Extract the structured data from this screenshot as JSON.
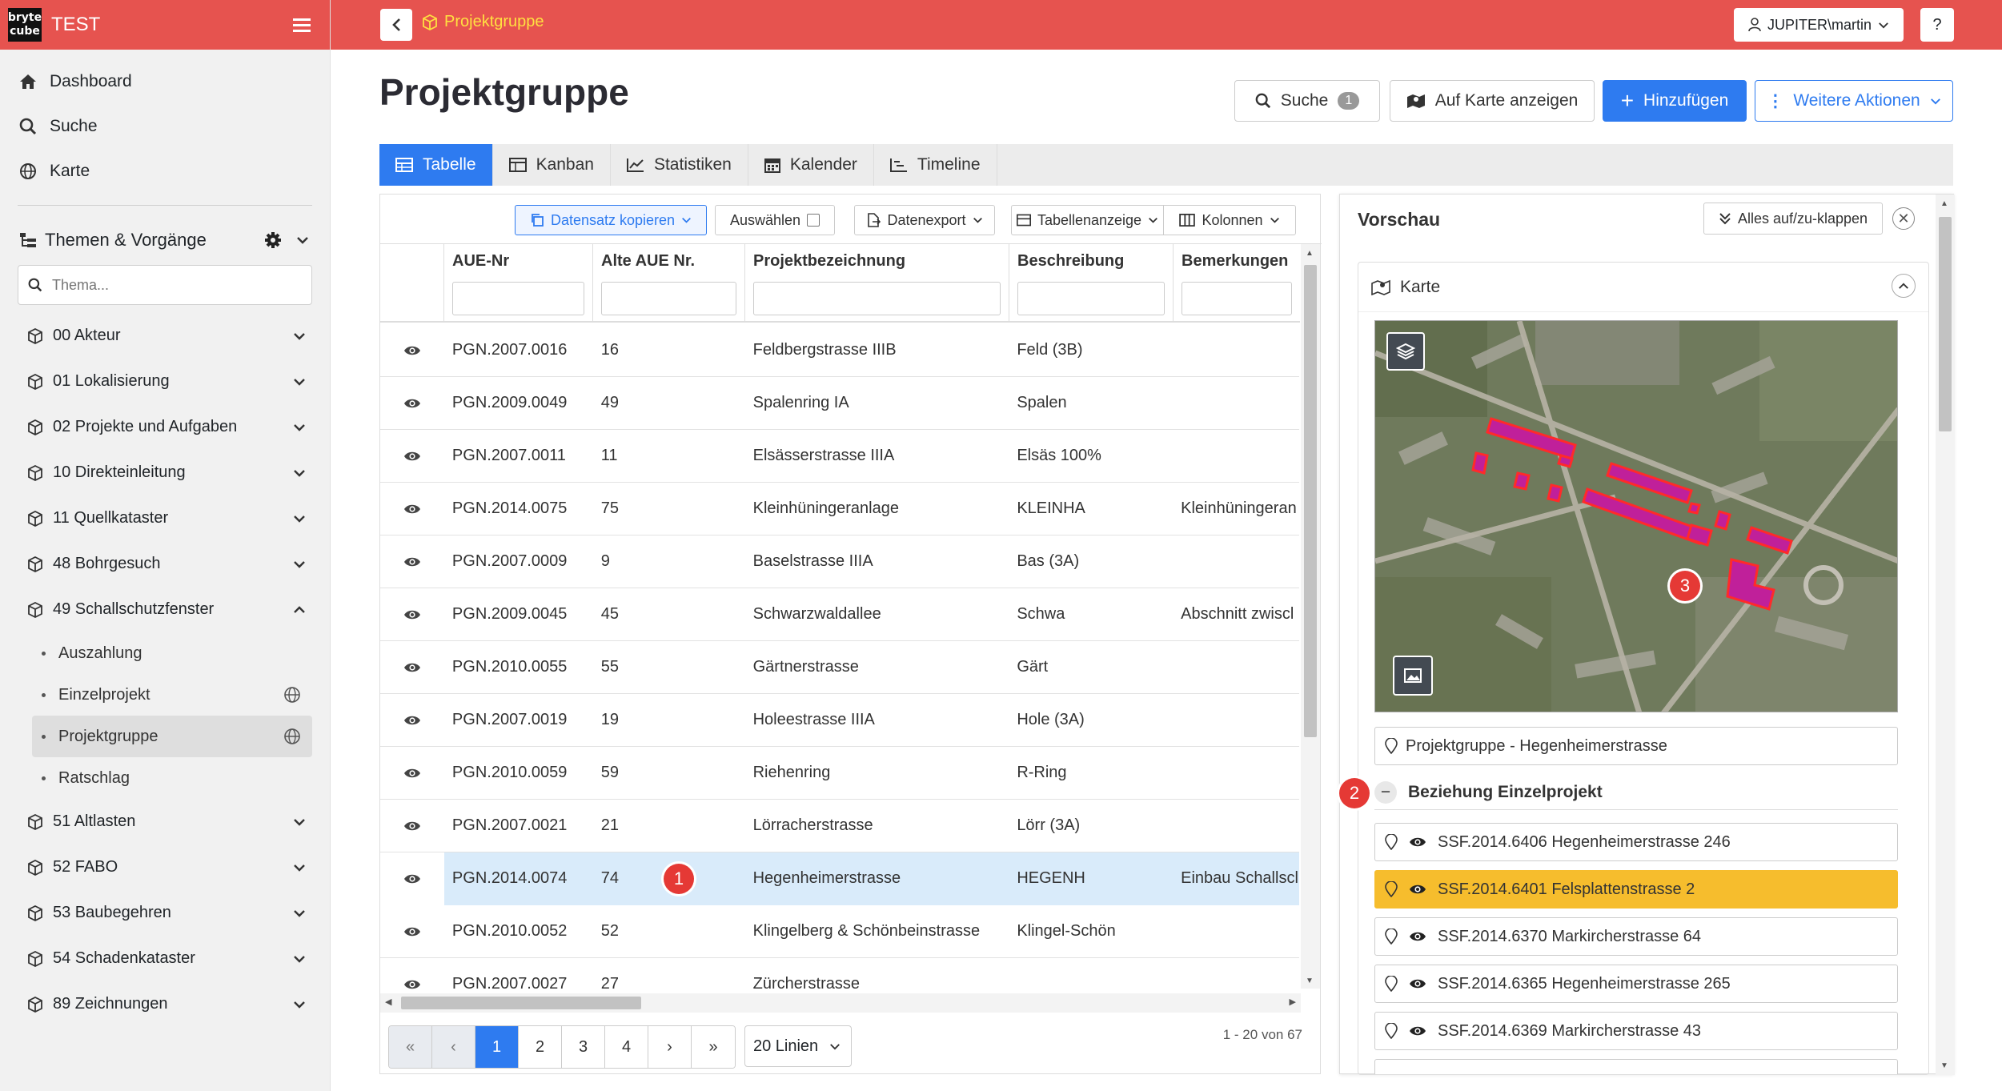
{
  "app": {
    "logo_line1": "bryte",
    "logo_line2": "cube",
    "title": "TEST"
  },
  "topbar": {
    "breadcrumb": "Projektgruppe",
    "user": "JUPITER\\martin",
    "help": "?"
  },
  "sidebar": {
    "links": [
      {
        "label": "Dashboard",
        "icon": "home-icon"
      },
      {
        "label": "Suche",
        "icon": "search-icon"
      },
      {
        "label": "Karte",
        "icon": "globe-icon"
      }
    ],
    "section_title": "Themen & Vorgänge",
    "search_placeholder": "Thema...",
    "groups": [
      {
        "label": "00 Akteur",
        "expanded": false
      },
      {
        "label": "01 Lokalisierung",
        "expanded": false
      },
      {
        "label": "02 Projekte und Aufgaben",
        "expanded": false
      },
      {
        "label": "10 Direkteinleitung",
        "expanded": false
      },
      {
        "label": "11 Quellkataster",
        "expanded": false
      },
      {
        "label": "48 Bohrgesuch",
        "expanded": false
      },
      {
        "label": "49 Schallschutzfenster",
        "expanded": true
      }
    ],
    "subitems": [
      {
        "label": "Auszahlung",
        "globe": false,
        "active": false
      },
      {
        "label": "Einzelprojekt",
        "globe": true,
        "active": false
      },
      {
        "label": "Projektgruppe",
        "globe": true,
        "active": true
      },
      {
        "label": "Ratschlag",
        "globe": false,
        "active": false
      }
    ],
    "groups_after": [
      {
        "label": "51 Altlasten"
      },
      {
        "label": "52 FABO"
      },
      {
        "label": "53 Baubegehren"
      },
      {
        "label": "54 Schadenkataster"
      },
      {
        "label": "89 Zeichnungen"
      }
    ]
  },
  "page": {
    "title": "Projektgruppe",
    "search_label": "Suche",
    "search_count": "1",
    "map_button": "Auf Karte anzeigen",
    "add_button": "Hinzufügen",
    "more_button": "Weitere Aktionen"
  },
  "tabs": [
    {
      "label": "Tabelle",
      "active": true
    },
    {
      "label": "Kanban",
      "active": false
    },
    {
      "label": "Statistiken",
      "active": false
    },
    {
      "label": "Kalender",
      "active": false
    },
    {
      "label": "Timeline",
      "active": false
    }
  ],
  "toolbar": {
    "copy": "Datensatz kopieren",
    "select": "Auswählen",
    "export": "Datenexport",
    "display": "Tabellenanzeige",
    "columns": "Kolonnen"
  },
  "table": {
    "columns": [
      "AUE-Nr",
      "Alte AUE Nr.",
      "Projektbezeichnung",
      "Beschreibung",
      "Bemerkungen"
    ],
    "rows": [
      [
        "PGN.2007.0016",
        "16",
        "Feldbergstrasse IIIB",
        "Feld (3B)",
        ""
      ],
      [
        "PGN.2009.0049",
        "49",
        "Spalenring IA",
        "Spalen",
        ""
      ],
      [
        "PGN.2007.0011",
        "11",
        "Elsässerstrasse IIIA",
        "Elsäs 100%",
        ""
      ],
      [
        "PGN.2014.0075",
        "75",
        "Kleinhüningeranlage",
        "KLEINHA",
        "Kleinhüningeran"
      ],
      [
        "PGN.2007.0009",
        "9",
        "Baselstrasse IIIA",
        "Bas (3A)",
        ""
      ],
      [
        "PGN.2009.0045",
        "45",
        "Schwarzwaldallee",
        "Schwa",
        "Abschnitt zwiscl"
      ],
      [
        "PGN.2010.0055",
        "55",
        "Gärtnerstrasse",
        "Gärt",
        ""
      ],
      [
        "PGN.2007.0019",
        "19",
        "Holeestrasse IIIA",
        "Hole (3A)",
        ""
      ],
      [
        "PGN.2010.0059",
        "59",
        "Riehenring",
        "R-Ring",
        ""
      ],
      [
        "PGN.2007.0021",
        "21",
        "Lörracherstrasse",
        "Lörr (3A)",
        ""
      ],
      [
        "PGN.2014.0074",
        "74",
        "Hegenheimerstrasse",
        "HEGENH",
        "Einbau Schallscl"
      ],
      [
        "PGN.2010.0052",
        "52",
        "Klingelberg & Schönbeinstrasse",
        "Klingel-Schön",
        ""
      ],
      [
        "PGN.2007.0027",
        "27",
        "Zürcherstrasse",
        "",
        ""
      ]
    ],
    "selected_index": 10
  },
  "pagination": {
    "pages": [
      "1",
      "2",
      "3",
      "4"
    ],
    "current": "1",
    "lines": "20 Linien",
    "count": "1 - 20 von 67"
  },
  "markers": {
    "m1": "1",
    "m2": "2",
    "m3": "3"
  },
  "preview": {
    "title": "Vorschau",
    "expand_all": "Alles auf/zu-klappen",
    "map_card_title": "Karte",
    "location": "Projektgruppe - Hegenheimerstrasse",
    "relation_title": "Beziehung Einzelprojekt",
    "relations": [
      {
        "label": "SSF.2014.6406 Hegenheimerstrasse 246",
        "highlight": false
      },
      {
        "label": "SSF.2014.6401 Felsplattenstrasse 2",
        "highlight": true
      },
      {
        "label": "SSF.2014.6370 Markircherstrasse 64",
        "highlight": false
      },
      {
        "label": "SSF.2014.6365 Hegenheimerstrasse 265",
        "highlight": false
      },
      {
        "label": "SSF.2014.6369 Markircherstrasse 43",
        "highlight": false
      }
    ]
  },
  "colors": {
    "topbar": "#e6534f",
    "primary": "#2e7bf0",
    "highlight": "#f6bd2d",
    "selected_row": "#d9ebfa",
    "polygon": "#c0209a"
  }
}
